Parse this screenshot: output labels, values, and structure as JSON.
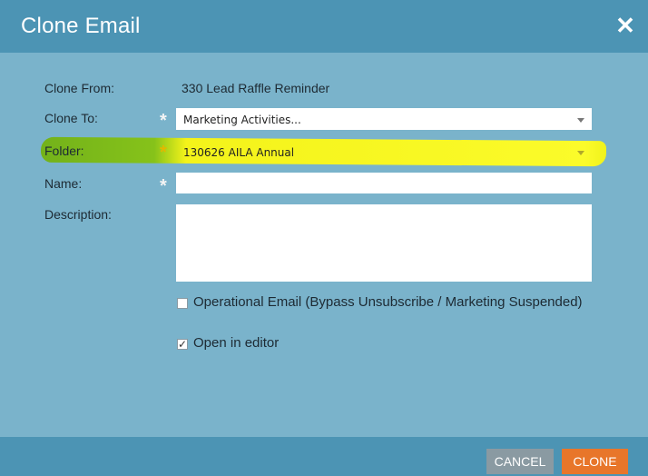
{
  "dialog": {
    "title": "Clone Email",
    "close_icon": "close-icon"
  },
  "form": {
    "clone_from": {
      "label": "Clone From:",
      "value": "330 Lead Raffle Reminder"
    },
    "clone_to": {
      "label": "Clone To:",
      "required_mark": "*",
      "value": "Marketing Activities..."
    },
    "folder": {
      "label": "Folder:",
      "required_mark": "*",
      "value": "130626 AILA Annual",
      "highlight_color": "#f4f31a",
      "label_highlight_color": "#73b21a"
    },
    "name": {
      "label": "Name:",
      "required_mark": "*",
      "value": ""
    },
    "description": {
      "label": "Description:",
      "value": ""
    },
    "operational_email": {
      "label": "Operational Email (Bypass Unsubscribe / Marketing Suspended)",
      "checked": false
    },
    "open_in_editor": {
      "label": "Open in editor",
      "checked": true,
      "check_mark": "✓"
    }
  },
  "footer": {
    "cancel_label": "CANCEL",
    "clone_label": "CLONE"
  },
  "colors": {
    "body": "#7ab3cb",
    "header": "#4c94b4",
    "cancel_button": "#8a9aa2",
    "clone_button": "#e8762a"
  }
}
